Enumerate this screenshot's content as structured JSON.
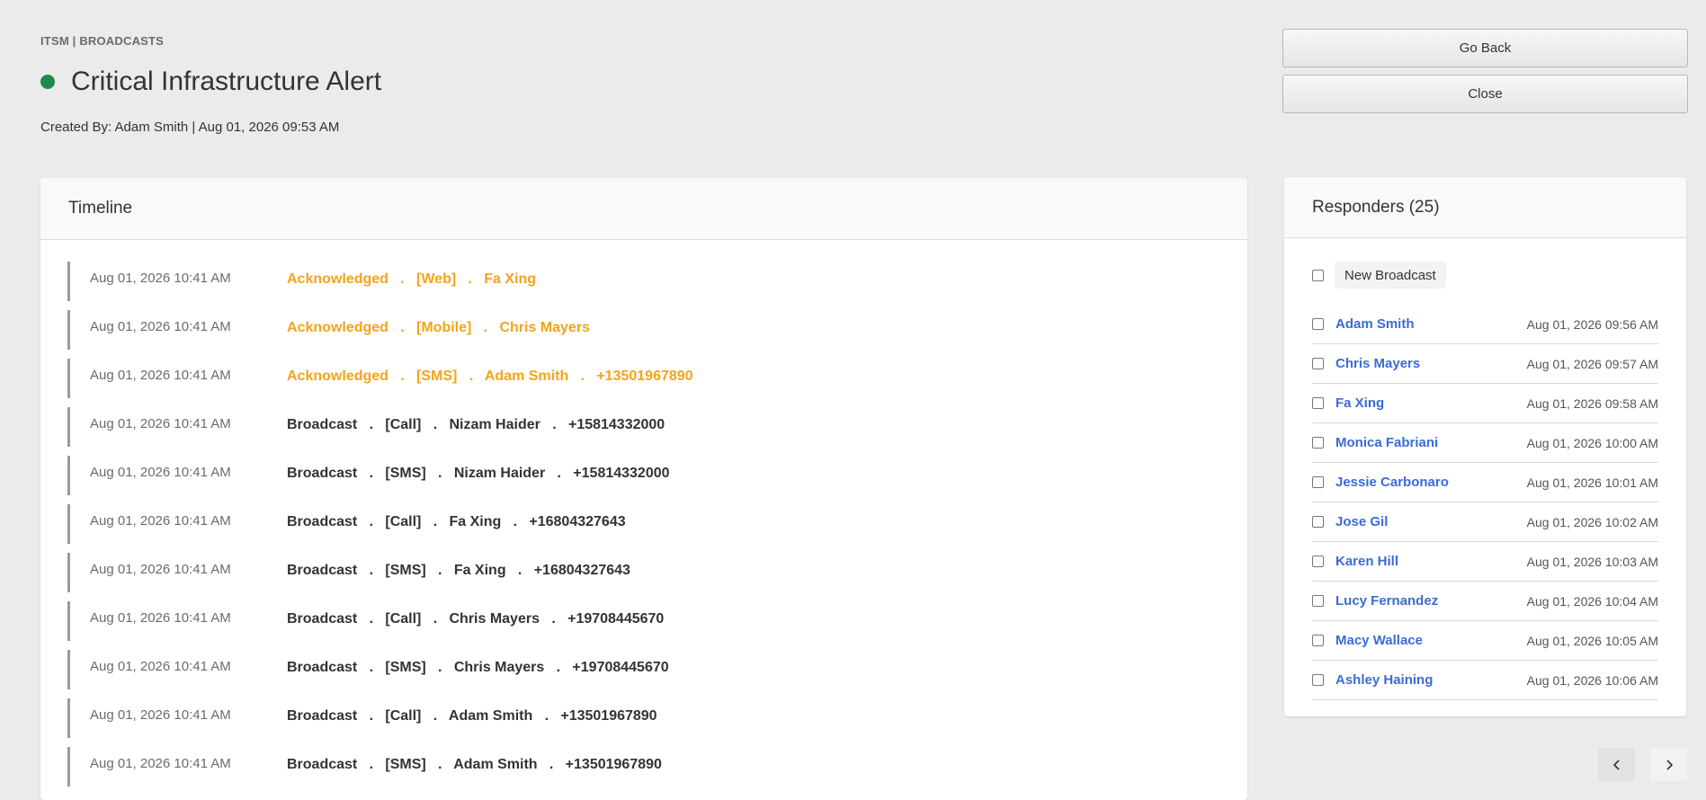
{
  "header": {
    "breadcrumb": "ITSM | BROADCASTS",
    "title": "Critical Infrastructure Alert",
    "created_by": "Created By: Adam Smith | Aug 01, 2026 09:53 AM",
    "status_color": "#1e8a4f"
  },
  "actions": {
    "go_back_label": "Go Back",
    "close_label": "Close"
  },
  "timeline": {
    "title": "Timeline",
    "entries": [
      {
        "time": "Aug 01, 2026 10:41 AM",
        "type": "ack",
        "event": "Acknowledged   .   [Web]   .   Fa Xing"
      },
      {
        "time": "Aug 01, 2026 10:41 AM",
        "type": "ack",
        "event": "Acknowledged   .   [Mobile]   .   Chris Mayers"
      },
      {
        "time": "Aug 01, 2026 10:41 AM",
        "type": "ack",
        "event": "Acknowledged   .   [SMS]   .   Adam Smith   .   +13501967890"
      },
      {
        "time": "Aug 01, 2026 10:41 AM",
        "type": "broadcast",
        "event": "Broadcast   .   [Call]   .   Nizam Haider   .   +15814332000"
      },
      {
        "time": "Aug 01, 2026 10:41 AM",
        "type": "broadcast",
        "event": "Broadcast   .   [SMS]   .   Nizam Haider   .   +15814332000"
      },
      {
        "time": "Aug 01, 2026 10:41 AM",
        "type": "broadcast",
        "event": "Broadcast   .   [Call]   .   Fa Xing   .   +16804327643"
      },
      {
        "time": "Aug 01, 2026 10:41 AM",
        "type": "broadcast",
        "event": "Broadcast   .   [SMS]   .   Fa Xing   .   +16804327643"
      },
      {
        "time": "Aug 01, 2026 10:41 AM",
        "type": "broadcast",
        "event": "Broadcast   .   [Call]   .   Chris Mayers   .   +19708445670"
      },
      {
        "time": "Aug 01, 2026 10:41 AM",
        "type": "broadcast",
        "event": "Broadcast   .   [SMS]   .   Chris Mayers   .   +19708445670"
      },
      {
        "time": "Aug 01, 2026 10:41 AM",
        "type": "broadcast",
        "event": "Broadcast   .   [Call]   .   Adam Smith   .   +13501967890"
      },
      {
        "time": "Aug 01, 2026 10:41 AM",
        "type": "broadcast",
        "event": "Broadcast   .   [SMS]   .   Adam Smith   .   +13501967890"
      }
    ],
    "ack_color": "#f5a31a"
  },
  "responders": {
    "title": "Responders (25)",
    "new_broadcast_label": "New Broadcast",
    "items": [
      {
        "name": "Adam Smith",
        "time": "Aug 01, 2026 09:56 AM"
      },
      {
        "name": "Chris Mayers",
        "time": "Aug 01, 2026 09:57 AM"
      },
      {
        "name": "Fa Xing",
        "time": "Aug 01, 2026 09:58 AM"
      },
      {
        "name": "Monica Fabriani",
        "time": "Aug 01, 2026 10:00 AM"
      },
      {
        "name": "Jessie Carbonaro",
        "time": "Aug 01, 2026 10:01 AM"
      },
      {
        "name": "Jose Gil",
        "time": "Aug 01, 2026 10:02 AM"
      },
      {
        "name": "Karen Hill",
        "time": "Aug 01, 2026 10:03 AM"
      },
      {
        "name": "Lucy Fernandez",
        "time": "Aug 01, 2026 10:04 AM"
      },
      {
        "name": "Macy Wallace",
        "time": "Aug 01, 2026 10:05 AM"
      },
      {
        "name": "Ashley Haining",
        "time": "Aug 01, 2026 10:06 AM"
      }
    ],
    "link_color": "#3a6cd6"
  },
  "pagination": {
    "prev_icon": "chevron-left-icon",
    "next_icon": "chevron-right-icon"
  }
}
